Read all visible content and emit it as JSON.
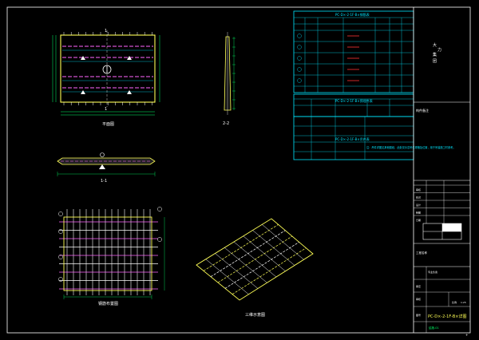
{
  "drawing": {
    "background": "#000000",
    "colors": {
      "frame": "#ffffff",
      "table": "#00e5ff",
      "outline": "#ffff55",
      "rebar": "#ff66ff",
      "dim": "#00ff66",
      "text_red": "#ff3333",
      "plan_bars": "#ffffff"
    }
  },
  "views": {
    "plan": {
      "caption": "平面图",
      "section_mark": "1"
    },
    "section_2": {
      "caption": "2-2"
    },
    "section_1": {
      "caption": "1-1"
    },
    "rebar_plan": {
      "caption": "钢筋布置图"
    },
    "iso": {
      "caption": "三维示意图"
    }
  },
  "tables": {
    "rebar": {
      "title": "PC-D×-2-1F-B×钢筋表"
    },
    "embed": {
      "title": "PC-D×-2-1F-B×预埋件表"
    },
    "lift": {
      "title": "PC-D×-2-1F-B×吊件表"
    },
    "lift_note": "注：吊件详图见其他图纸，此处仅示意吊件规格及位置，用于吊装施工时参考。"
  },
  "title_block": {
    "company": [
      "大",
      "力",
      "集",
      "团"
    ],
    "notes_label": "构件备注",
    "row_labels": [
      "审核",
      "校对",
      "设计",
      "制图",
      "日期"
    ],
    "project_label": "工程名称",
    "check_label": "专业负责",
    "drawing_name": "PC-D×-2-1F-B×详图",
    "bottom_labels": [
      "审定",
      "审核",
      "图号"
    ],
    "scale_label": "比例",
    "scale_value": "1:25",
    "sheet_code": "结施-01"
  }
}
